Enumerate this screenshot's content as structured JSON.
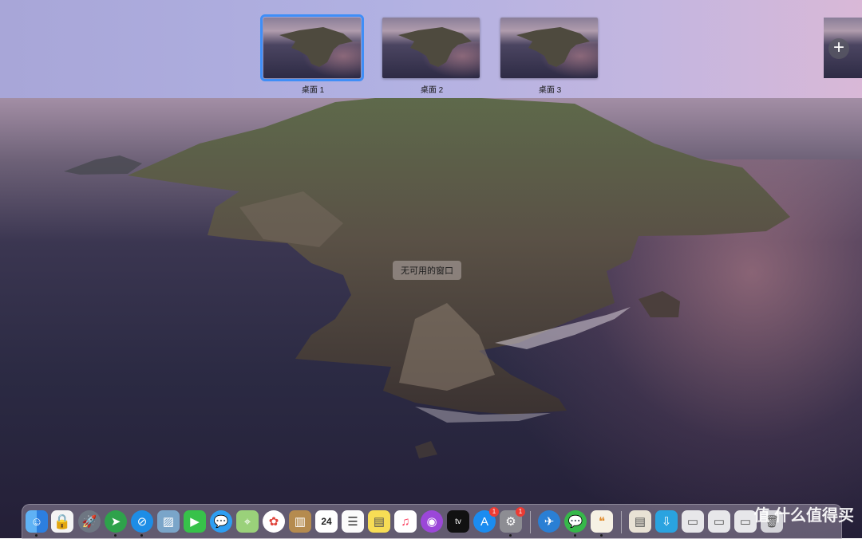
{
  "spaces": [
    {
      "label": "桌面 1",
      "active": true
    },
    {
      "label": "桌面 2",
      "active": false
    },
    {
      "label": "桌面 3",
      "active": false
    }
  ],
  "add_space": {
    "symbol": "+"
  },
  "desktop": {
    "no_windows_text": "无可用的窗口"
  },
  "dock": {
    "items": [
      {
        "name": "finder",
        "icon": "finder-icon",
        "running": true
      },
      {
        "name": "lock",
        "icon": "lock-icon",
        "running": false
      },
      {
        "name": "launchpad",
        "icon": "rocket-icon",
        "running": false
      },
      {
        "name": "telegram",
        "icon": "paper-plane-icon",
        "running": true
      },
      {
        "name": "safari",
        "icon": "compass-icon",
        "running": true
      },
      {
        "name": "preview",
        "icon": "preview-icon",
        "running": false
      },
      {
        "name": "facetime",
        "icon": "camera-icon",
        "running": false
      },
      {
        "name": "messages",
        "icon": "chat-bubble-icon",
        "running": false
      },
      {
        "name": "maps",
        "icon": "map-icon",
        "running": false
      },
      {
        "name": "photos",
        "icon": "flower-icon",
        "running": false
      },
      {
        "name": "contacts",
        "icon": "book-icon",
        "running": false
      },
      {
        "name": "calendar",
        "icon": "calendar-icon",
        "running": false,
        "day": "24"
      },
      {
        "name": "reminders",
        "icon": "list-icon",
        "running": false
      },
      {
        "name": "notes",
        "icon": "note-icon",
        "running": false
      },
      {
        "name": "music",
        "icon": "music-note-icon",
        "running": false
      },
      {
        "name": "podcasts",
        "icon": "podcast-icon",
        "running": false
      },
      {
        "name": "tv",
        "icon": "tv-icon",
        "running": false,
        "text": "tv"
      },
      {
        "name": "app-store",
        "icon": "app-store-icon",
        "running": false,
        "badge": "1"
      },
      {
        "name": "system-preferences",
        "icon": "gear-icon",
        "running": true,
        "badge": "1"
      },
      {
        "name": "send",
        "icon": "bird-icon",
        "running": false
      },
      {
        "name": "wechat",
        "icon": "wechat-icon",
        "running": true
      },
      {
        "name": "quote-app",
        "icon": "quote-icon",
        "running": true
      },
      {
        "name": "document-1",
        "icon": "document-icon",
        "running": false
      },
      {
        "name": "download",
        "icon": "download-icon",
        "running": false
      },
      {
        "name": "document-2",
        "icon": "folder-stack-icon",
        "running": false
      },
      {
        "name": "document-3",
        "icon": "folder-stack-icon",
        "running": false
      },
      {
        "name": "document-4",
        "icon": "folder-stack-icon",
        "running": false
      },
      {
        "name": "trash",
        "icon": "trash-icon",
        "running": false
      }
    ]
  },
  "watermark": "值 什么值得买"
}
